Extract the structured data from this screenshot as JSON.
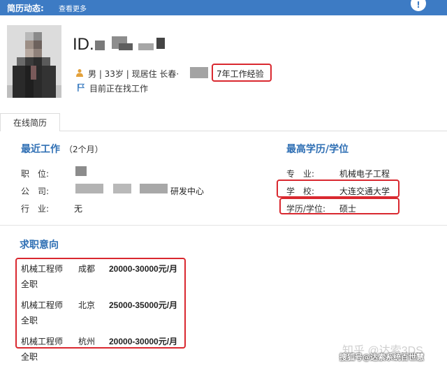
{
  "topbar": {
    "title": "简历动态:",
    "more_link": "查看更多",
    "corner_icon": "info-icon",
    "corner_glyph": "!"
  },
  "profile": {
    "id_prefix": "ID.",
    "info_line": "男 | 33岁 | 现居住 长春·",
    "experience": "7年工作经验",
    "status": "目前正在找工作"
  },
  "tabs": [
    "在线简历"
  ],
  "recent_work": {
    "heading": "最近工作",
    "duration": "（2个月）",
    "position_label": "职　位:",
    "company_label": "公　司:",
    "company_suffix": "研发中心",
    "industry_label": "行　业:",
    "industry_value": "无"
  },
  "education": {
    "heading": "最高学历/学位",
    "major_label": "专　业:",
    "major_value": "机械电子工程",
    "school_label": "学　校:",
    "school_value": "大连交通大学",
    "degree_label": "学历/学位:",
    "degree_value": "硕士"
  },
  "job_intention": {
    "heading": "求职意向",
    "items": [
      {
        "title": "机械工程师",
        "city": "成都",
        "salary": "20000-30000元/月",
        "type": "全职"
      },
      {
        "title": "机械工程师",
        "city": "北京",
        "salary": "25000-35000元/月",
        "type": "全职"
      },
      {
        "title": "机械工程师",
        "city": "杭州",
        "salary": "20000-30000元/月",
        "type": "全职"
      }
    ]
  },
  "watermark": "知乎 @达索3DS",
  "credit": "搜狐号@达索系统百世慧",
  "colors": {
    "topbar": "#3d7bc4",
    "heading": "#2f6fb4",
    "highlight_box": "#d9282f"
  }
}
